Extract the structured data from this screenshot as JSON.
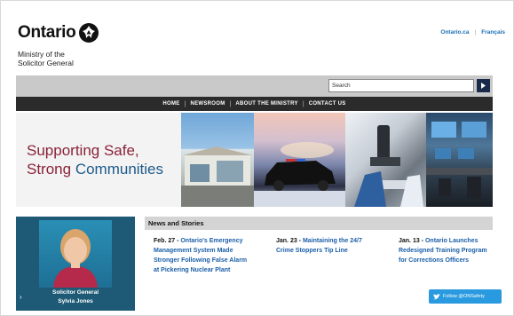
{
  "header": {
    "brand": "Ontario",
    "ministry_line1": "Ministry of the",
    "ministry_line2": "Solicitor General",
    "links": [
      "Ontario.ca",
      "Français"
    ]
  },
  "search": {
    "placeholder": "Search",
    "value": "Search"
  },
  "nav": {
    "items": [
      "HOME",
      "NEWSROOM",
      "ABOUT THE MINISTRY",
      "CONTACT US"
    ]
  },
  "banner": {
    "line1": "Supporting Safe,",
    "line2_start": "Strong ",
    "line2_end": "Communities"
  },
  "profile": {
    "title": "Solicitor General",
    "name": "Sylvia Jones"
  },
  "news": {
    "heading": "News and Stories",
    "stories": [
      {
        "date": "Feb. 27 - ",
        "title": "Ontario's Emergency Management System Made Stronger Following False Alarm at Pickering Nuclear Plant"
      },
      {
        "date": "Jan. 23 - ",
        "title": "Maintaining the 24/7 Crime Stoppers Tip Line"
      },
      {
        "date": "Jan. 13 - ",
        "title": "Ontario Launches Redesigned Training Program for Corrections Officers"
      }
    ]
  },
  "twitter": {
    "label": "Follow @ONSafety"
  },
  "colors": {
    "banner_red": "#8a2238",
    "banner_blue": "#1e5a8a",
    "link_blue": "#1b5fa8",
    "nav_bg": "#2b2b2b",
    "twitter_blue": "#2a9ae0",
    "profile_bg": "#1e5a75"
  }
}
